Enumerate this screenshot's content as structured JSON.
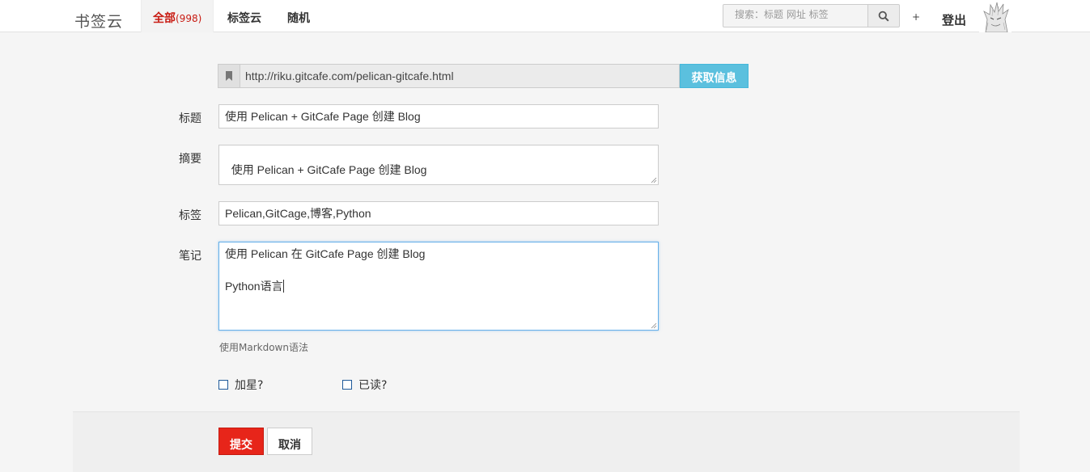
{
  "nav": {
    "brand": "书签云",
    "tabs": [
      {
        "label": "全部",
        "count": "(998)"
      },
      {
        "label": "标签云"
      },
      {
        "label": "随机"
      }
    ],
    "search_placeholder": "搜索：标题 网址 标签",
    "plus_label": "+",
    "logout_label": "登出"
  },
  "form": {
    "url_value": "http://riku.gitcafe.com/pelican-gitcafe.html",
    "fetch_label": "获取信息",
    "title_label": "标题",
    "title_value": "使用 Pelican + GitCafe Page 创建 Blog",
    "summary_label": "摘要",
    "summary_value": "使用 Pelican + GitCafe Page 创建 Blog",
    "tags_label": "标签",
    "tags_value": "Pelican,GitCage,博客,Python",
    "notes_label": "笔记",
    "notes_line1": "使用 Pelican 在 GitCafe Page 创建 Blog",
    "notes_line2": "Python语言",
    "help_text": "使用Markdown语法",
    "star_label": "加星?",
    "read_label": "已读?",
    "submit_label": "提交",
    "cancel_label": "取消"
  },
  "icons": {
    "search": "search-icon",
    "bookmark": "bookmark-icon",
    "avatar": "avatar-image"
  }
}
